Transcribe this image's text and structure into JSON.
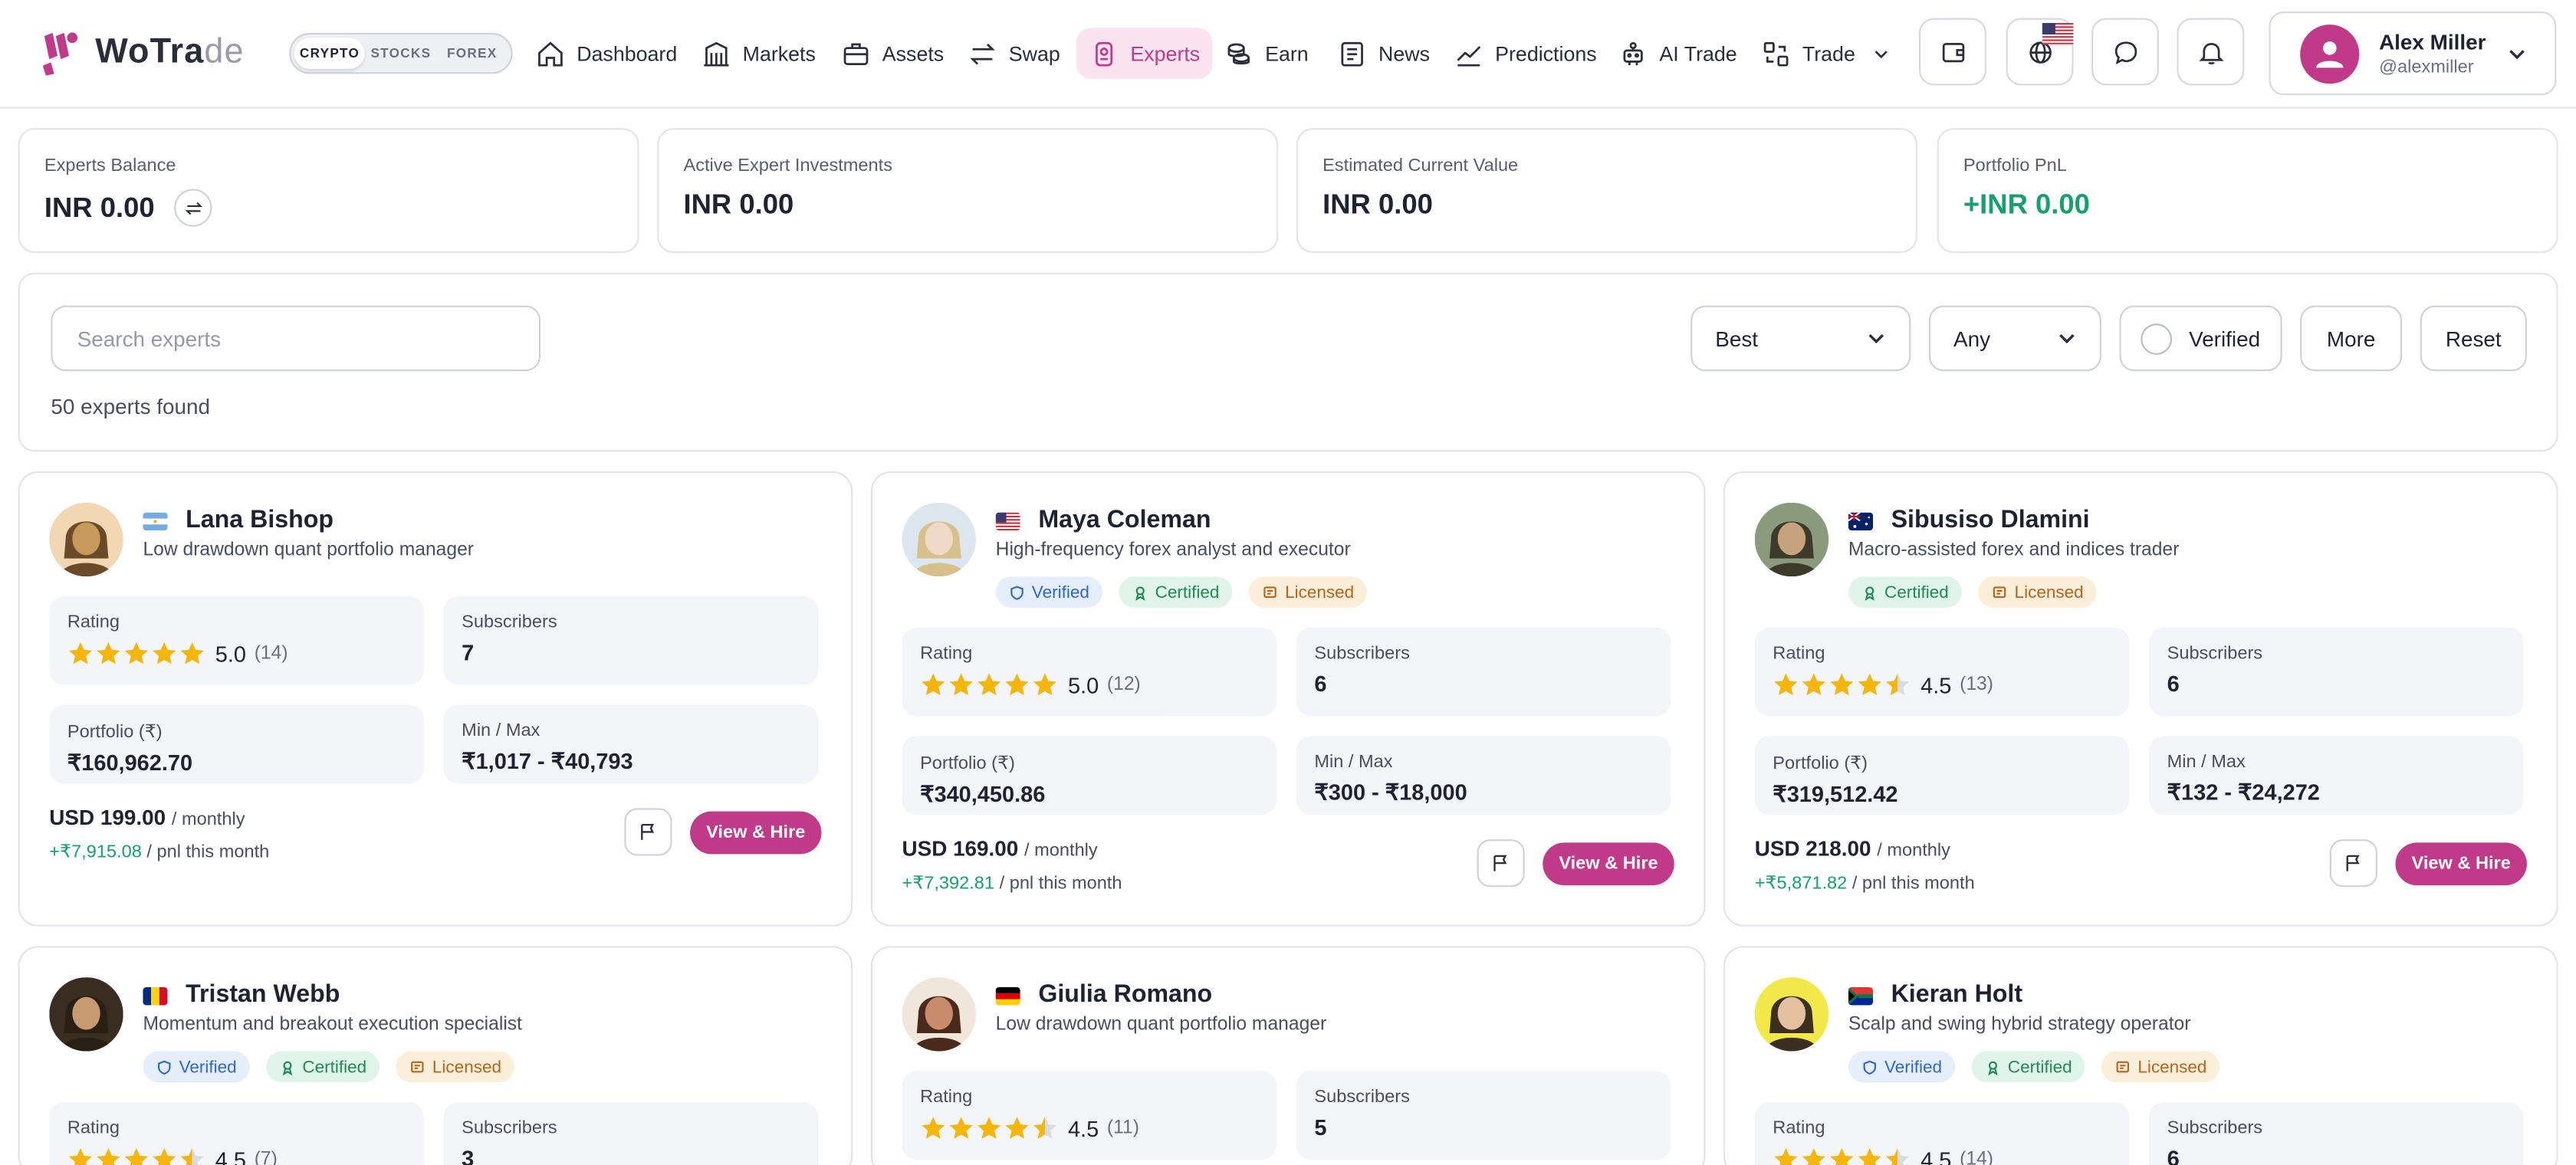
{
  "brand": {
    "name_main": "WoTra",
    "name_light": "de"
  },
  "market_toggle": [
    "CRYPTO",
    "STOCKS",
    "FOREX"
  ],
  "nav": [
    {
      "label": "Dashboard",
      "icon": "home-icon"
    },
    {
      "label": "Markets",
      "icon": "building-icon"
    },
    {
      "label": "Assets",
      "icon": "briefcase-icon"
    },
    {
      "label": "Swap",
      "icon": "swap-arrows-icon"
    },
    {
      "label": "Experts",
      "icon": "badge-icon",
      "active": true
    },
    {
      "label": "Earn",
      "icon": "coins-icon"
    },
    {
      "label": "News",
      "icon": "newspaper-icon"
    },
    {
      "label": "Predictions",
      "icon": "trend-line-icon"
    },
    {
      "label": "AI Trade",
      "icon": "robot-icon"
    },
    {
      "label": "Trade",
      "icon": "trade-exchange-icon"
    }
  ],
  "header_buttons": [
    "wallet-icon",
    "globe-icon",
    "chat-icon",
    "bell-icon"
  ],
  "user": {
    "name": "Alex Miller",
    "handle": "@alexmiller"
  },
  "stats": [
    {
      "label": "Experts Balance",
      "value": "INR 0.00"
    },
    {
      "label": "Active Expert Investments",
      "value": "INR 0.00"
    },
    {
      "label": "Estimated Current Value",
      "value": "INR 0.00"
    },
    {
      "label": "Portfolio PnL",
      "value": "+INR 0.00"
    }
  ],
  "filters": {
    "search_placeholder": "Search experts",
    "sort": "Best",
    "range": "Any",
    "verified": "Verified",
    "more": "More",
    "reset": "Reset",
    "found": "50 experts found"
  },
  "card_labels": {
    "rating": "Rating",
    "subscribers": "Subscribers",
    "portfolio": "Portfolio (₹)",
    "minmax": "Min / Max",
    "monthly": "/ monthly",
    "pnl_suffix": "/ pnl this month",
    "hire": "View & Hire",
    "verified": "Verified",
    "certified": "Certified",
    "licensed": "Licensed"
  },
  "experts": [
    {
      "name": "Lana Bishop",
      "desc": "Low drawdown quant portfolio manager",
      "flag": "argentina",
      "badges": [],
      "rating": 5.0,
      "rating_text": "5.0",
      "reviews": "(14)",
      "subscribers": "7",
      "portfolio": "₹160,962.70",
      "minmax": "₹1,017 - ₹40,793",
      "price": "USD 199.00",
      "pnl": "+₹7,915.08"
    },
    {
      "name": "Maya Coleman",
      "desc": "High-frequency forex analyst and executor",
      "flag": "usa",
      "badges": [
        "verified",
        "certified",
        "licensed"
      ],
      "rating": 5.0,
      "rating_text": "5.0",
      "reviews": "(12)",
      "subscribers": "6",
      "portfolio": "₹340,450.86",
      "minmax": "₹300 - ₹18,000",
      "price": "USD 169.00",
      "pnl": "+₹7,392.81"
    },
    {
      "name": "Sibusiso Dlamini",
      "desc": "Macro-assisted forex and indices trader",
      "flag": "australia",
      "badges": [
        "certified",
        "licensed"
      ],
      "rating": 4.5,
      "rating_text": "4.5",
      "reviews": "(13)",
      "subscribers": "6",
      "portfolio": "₹319,512.42",
      "minmax": "₹132 - ₹24,272",
      "price": "USD 218.00",
      "pnl": "+₹5,871.82"
    },
    {
      "name": "Tristan Webb",
      "desc": "Momentum and breakout execution specialist",
      "flag": "romania",
      "badges": [
        "verified",
        "certified",
        "licensed"
      ],
      "rating": 4.5,
      "rating_text": "4.5",
      "reviews": "(7)",
      "subscribers": "3"
    },
    {
      "name": "Giulia Romano",
      "desc": "Low drawdown quant portfolio manager",
      "flag": "germany",
      "badges": [],
      "rating": 4.5,
      "rating_text": "4.5",
      "reviews": "(11)",
      "subscribers": "5"
    },
    {
      "name": "Kieran Holt",
      "desc": "Scalp and swing hybrid strategy operator",
      "flag": "south-africa",
      "badges": [
        "verified",
        "certified",
        "licensed"
      ],
      "rating": 4.5,
      "rating_text": "4.5",
      "reviews": "(14)",
      "subscribers": "6"
    }
  ],
  "colors": {
    "accent": "#c13a89",
    "positive": "#17a06a",
    "star": "#f5b50a"
  }
}
